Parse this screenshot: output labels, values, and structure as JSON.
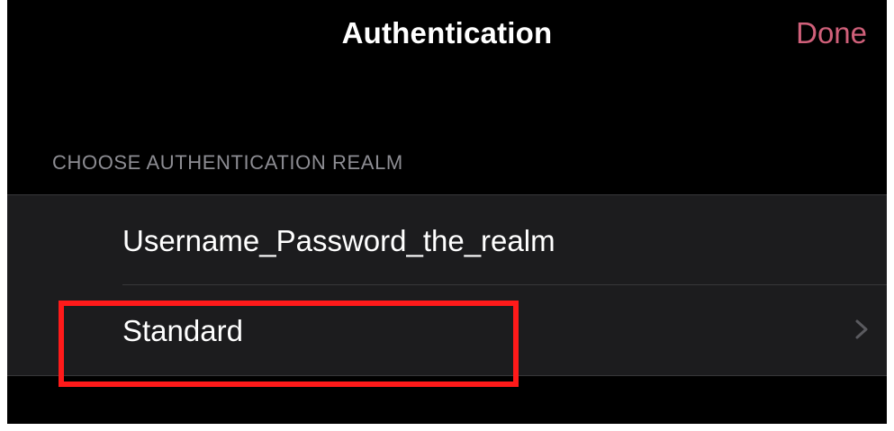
{
  "nav": {
    "title": "Authentication",
    "done_label": "Done"
  },
  "section": {
    "header": "CHOOSE AUTHENTICATION REALM"
  },
  "realms": [
    {
      "label": "Username_Password_the_realm",
      "accessory": null
    },
    {
      "label": "Standard",
      "accessory": "chevron-right-icon"
    }
  ],
  "colors": {
    "background": "#000000",
    "cell_background": "#1c1c1e",
    "accent": "#d0607a",
    "section_header": "#8d8d93",
    "highlight": "#ff1a1a"
  }
}
